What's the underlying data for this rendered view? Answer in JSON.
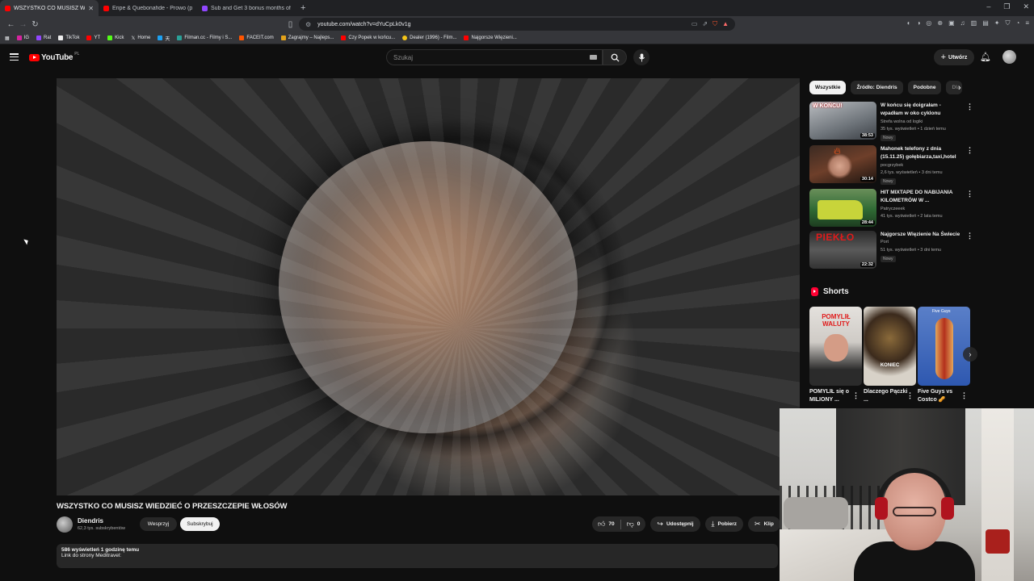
{
  "browser": {
    "tabs": [
      {
        "title": "WSZYSTKO CO MUSISZ WIED",
        "color": "#ff0000",
        "active": true
      },
      {
        "title": "Eripe & Quebonafide - Prowo (proc",
        "color": "#ff0000",
        "active": false
      },
      {
        "title": "Sub and Get 3 bonus months of Dis",
        "color": "#9147ff",
        "active": false
      }
    ],
    "new_tab": "+",
    "url": "youtube.com/watch?v=dYuCpLk0v1g",
    "bookmarks": [
      {
        "label": "IG",
        "color": "#d6249f"
      },
      {
        "label": "Rat",
        "color": "#9147ff"
      },
      {
        "label": "TikTok",
        "color": "#111111"
      },
      {
        "label": "YT",
        "color": "#ff0000"
      },
      {
        "label": "Kick",
        "color": "#53fc18"
      },
      {
        "label": "Home",
        "color": "#444444"
      },
      {
        "label": "",
        "color": "#1da1f2"
      },
      {
        "label": "Filman.cc - Filmy i S...",
        "color": "#2aa198"
      },
      {
        "label": "FACEIT.com",
        "color": "#ff5500"
      },
      {
        "label": "Zagrajmy – Najleps...",
        "color": "#e3a21a"
      },
      {
        "label": "Czy Popek w końcu...",
        "color": "#ff0000"
      },
      {
        "label": "Dealer (1996) - Film...",
        "color": "#f5c518"
      },
      {
        "label": "Najgorsze Więzieni...",
        "color": "#ff0000"
      }
    ]
  },
  "masthead": {
    "logo_word": "YouTube",
    "country": "PL",
    "search_placeholder": "Szukaj",
    "create_label": "Utwórz"
  },
  "video": {
    "title": "WSZYSTKO CO MUSISZ WIEDZIEĆ O PRZESZCZEPIE WŁOSÓW",
    "channel": "Diendris",
    "subscribers": "62,3 tys. subskrybentów",
    "support_label": "Wesprzyj",
    "subscribe_label": "Subskrybuj",
    "likes": "70",
    "dislikes": "0",
    "share_label": "Udostępnij",
    "download_label": "Pobierz",
    "clip_label": "Klip",
    "description_stats": "586 wyświetleń  1 godzinę temu",
    "description_text": "Link do strony Meditravel:"
  },
  "chips": [
    "Wszystkie",
    "Źródło: Diendris",
    "Podobne",
    "Dla"
  ],
  "recommendations": [
    {
      "title": "W końcu się doigrałam - wpadłam w oko cyklonu",
      "channel": "Strefa wolna od logiki",
      "views": "35 tys. wyświetleń • 1 dzień temu",
      "badge": "Nowy",
      "duration": "38:53",
      "thumb_color": "#8a8f96",
      "thumb_text": "W KOŃCU!"
    },
    {
      "title": "Mahonek telefony z dnia (15.11.25) gołębiarza,taxi,hotel",
      "channel": "pocgrzybek",
      "views": "2,6 tys. wyświetleń • 3 dni temu",
      "badge": "Nowy",
      "duration": "30:14",
      "thumb_color": "#7a5a4a",
      "thumb_text": ""
    },
    {
      "title": "HIT MIXTAPE DO NABIJANIA KILOMETRÓW W ...",
      "channel": "Patryczeeek",
      "views": "41 tys. wyświetleń • 2 lata temu",
      "badge": "",
      "duration": "28:44",
      "thumb_color": "#3d7a3a",
      "thumb_text": "HIT"
    },
    {
      "title": "Najgorsze Więzienie Na Świecie",
      "channel": "Port",
      "views": "51 tys. wyświetleń • 3 dni temu",
      "badge": "Nowy",
      "duration": "22:32",
      "thumb_color": "#5a5a5a",
      "thumb_text": "PIEKŁO"
    }
  ],
  "shorts": {
    "heading": "Shorts",
    "items": [
      {
        "title": "POMYLIŁ się o MILIONY ...",
        "thumb_color": "#d9d6d2",
        "thumb_text": "POMYLIŁ WALUTY"
      },
      {
        "title": "Dlaczego Pączki ...",
        "thumb_color": "#4a3a2a",
        "thumb_text": "KONIEC"
      },
      {
        "title": "Five Guys vs Costco 🥜",
        "thumb_color": "#3a5fa8",
        "thumb_text": "Five Guys"
      }
    ]
  }
}
